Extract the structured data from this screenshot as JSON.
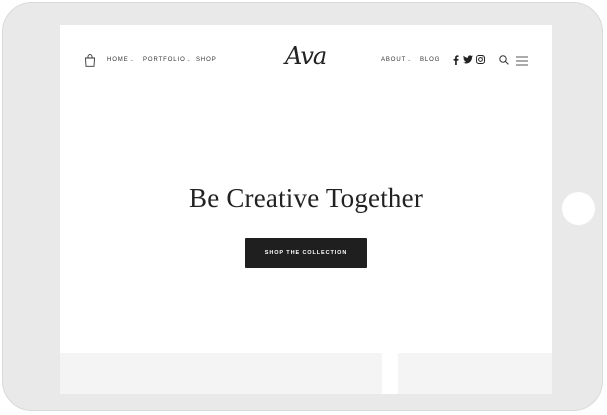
{
  "header": {
    "logo": "Ava",
    "nav_left": [
      {
        "label": "HOME",
        "dropdown": true
      },
      {
        "label": "PORTFOLIO",
        "dropdown": true
      },
      {
        "label": "SHOP",
        "dropdown": false
      }
    ],
    "nav_right": [
      {
        "label": "ABOUT",
        "dropdown": true
      },
      {
        "label": "BLOG",
        "dropdown": false
      }
    ],
    "caret_glyph": "⌄",
    "social_icons": [
      "facebook-icon",
      "twitter-icon",
      "instagram-icon"
    ]
  },
  "hero": {
    "title": "Be Creative Together",
    "cta_label": "SHOP THE COLLECTION"
  },
  "colors": {
    "device_bezel": "#e9e9e9",
    "text": "#222222",
    "button_bg": "#1f1f1f",
    "panel_bg": "#f4f4f4"
  }
}
